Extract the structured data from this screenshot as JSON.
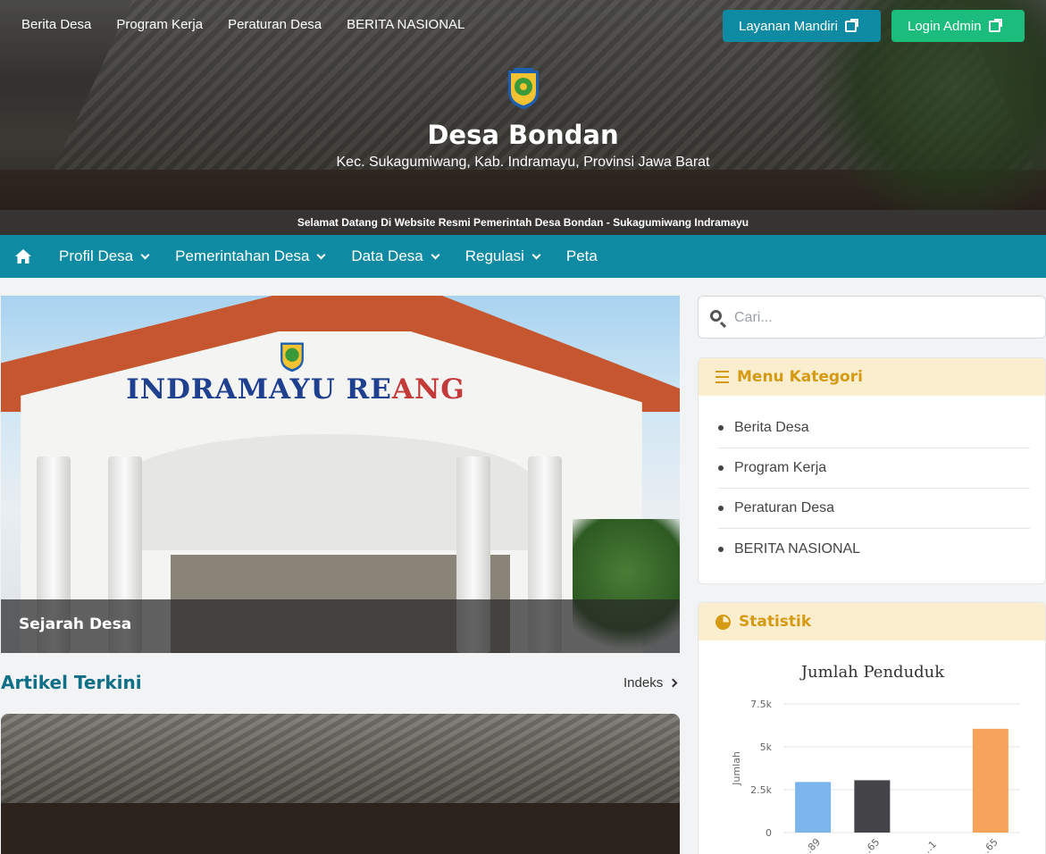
{
  "header": {
    "top_links": [
      "Berita Desa",
      "Program Kerja",
      "Peraturan Desa",
      "BERITA NASIONAL"
    ],
    "layanan_button": "Layanan Mandiri",
    "login_button": "Login Admin",
    "site_title": "Desa Bondan",
    "site_subtitle": "Kec. Sukagumiwang, Kab. Indramayu, Provinsi Jawa Barat",
    "ticker": "Selamat Datang Di Website Resmi Pemerintah Desa Bondan - Sukagumiwang Indramayu"
  },
  "main_nav": {
    "items": [
      {
        "label": "Profil Desa",
        "has_dropdown": true
      },
      {
        "label": "Pemerintahan Desa",
        "has_dropdown": true
      },
      {
        "label": "Data Desa",
        "has_dropdown": true
      },
      {
        "label": "Regulasi",
        "has_dropdown": true
      },
      {
        "label": "Peta",
        "has_dropdown": false
      }
    ]
  },
  "featured": {
    "sign_text_blue": "INDRAMAYU RE",
    "sign_text_red": "ANG",
    "caption": "Sejarah Desa"
  },
  "articles": {
    "title": "Artikel Terkini",
    "index_link": "Indeks"
  },
  "sidebar": {
    "search_placeholder": "Cari...",
    "kategori": {
      "title": "Menu Kategori",
      "items": [
        "Berita Desa",
        "Program Kerja",
        "Peraturan Desa",
        "BERITA NASIONAL"
      ]
    },
    "statistik": {
      "title": "Statistik"
    }
  },
  "colors": {
    "primary": "#0e8aa3",
    "login_green": "#1cbc7d",
    "accent_gold": "#d59a12",
    "card_head_bg": "#fbeecf"
  },
  "chart_data": {
    "type": "bar",
    "title": "Jumlah Penduduk",
    "ylabel": "Jumlah",
    "ylim": [
      0,
      7500
    ],
    "yticks": [
      "0",
      "2.5k",
      "5k",
      "7.5k"
    ],
    "categories": [
      "…89",
      "…65",
      "…1",
      "…65"
    ],
    "values": [
      2950,
      3050,
      0,
      6050
    ],
    "bar_colors": [
      "#7cb5ec",
      "#434348",
      "#90ed7d",
      "#f7a35c"
    ]
  }
}
